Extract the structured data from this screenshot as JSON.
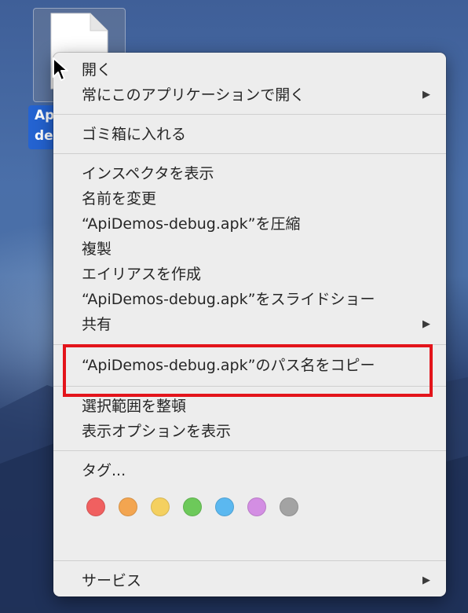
{
  "desktop": {
    "file_label": "Api\nde"
  },
  "menu": {
    "group1": [
      {
        "label": "開く",
        "submenu": false
      },
      {
        "label": "常にこのアプリケーションで開く",
        "submenu": true
      }
    ],
    "group2": [
      {
        "label": "ゴミ箱に入れる",
        "submenu": false
      }
    ],
    "group3": [
      {
        "label": "インスペクタを表示",
        "submenu": false
      },
      {
        "label": "名前を変更",
        "submenu": false
      },
      {
        "label": "“ApiDemos-debug.apk”を圧縮",
        "submenu": false
      },
      {
        "label": "複製",
        "submenu": false
      },
      {
        "label": "エイリアスを作成",
        "submenu": false
      },
      {
        "label": "“ApiDemos-debug.apk”をスライドショー",
        "submenu": false
      },
      {
        "label": "共有",
        "submenu": true
      }
    ],
    "group4": [
      {
        "label": "“ApiDemos-debug.apk”のパス名をコピー",
        "submenu": false
      }
    ],
    "group5": [
      {
        "label": "選択範囲を整頓",
        "submenu": false
      },
      {
        "label": "表示オプションを表示",
        "submenu": false
      }
    ],
    "tags_label": "タグ...",
    "tag_colors": [
      "#f06060",
      "#f3a550",
      "#f4d060",
      "#6dc95a",
      "#5bb8f0",
      "#d38ee3",
      "#a3a3a3"
    ],
    "services_label": "サービス",
    "submenu_arrow": "▶"
  },
  "colors": {
    "highlight": "#e3141b",
    "selection": "#2463d1"
  }
}
